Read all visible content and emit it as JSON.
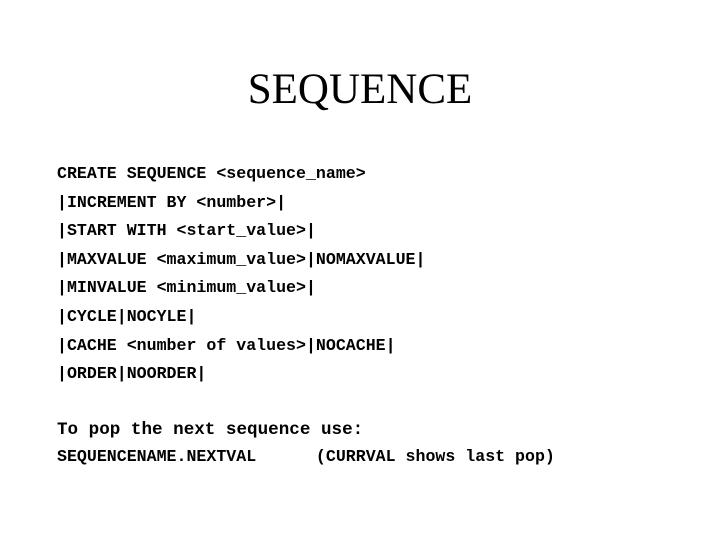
{
  "slide": {
    "title": "SEQUENCE",
    "background_color": "#ffffff",
    "text_color": "#000000"
  },
  "syntax": {
    "lines": [
      "CREATE SEQUENCE <sequence_name>",
      "|INCREMENT BY <number>|",
      "|START WITH <start_value>|",
      "|MAXVALUE <maximum_value>|NOMAXVALUE|",
      "|MINVALUE <minimum_value>|",
      "|CYCLE|NOCYLE|",
      "|CACHE <number of values>|NOCACHE|",
      "|ORDER|NOORDER|"
    ]
  },
  "usage": {
    "heading": "To pop the next sequence use:",
    "example": "SEQUENCENAME.NEXTVAL      (CURRVAL shows last pop)"
  }
}
